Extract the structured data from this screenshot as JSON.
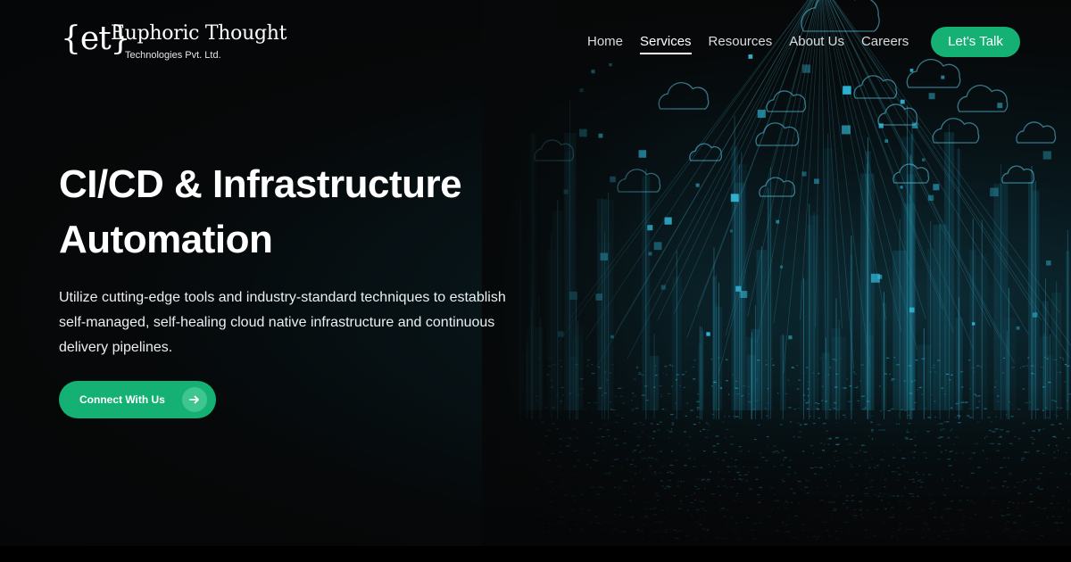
{
  "brand": {
    "mark": "{et}",
    "name": "Euphoric Thought",
    "subtitle": "Technologies Pvt. Ltd."
  },
  "nav": {
    "items": [
      {
        "label": "Home",
        "active": false
      },
      {
        "label": "Services",
        "active": true
      },
      {
        "label": "Resources",
        "active": false
      },
      {
        "label": "About Us",
        "active": false
      },
      {
        "label": "Careers",
        "active": false
      }
    ],
    "cta_label": "Let's Talk"
  },
  "hero": {
    "headline_line1": "CI/CD & Infrastructure",
    "headline_line2": "Automation",
    "subtext": "Utilize cutting-edge tools and industry-standard techniques to establish self-managed, self-healing cloud native infrastructure and continuous delivery pipelines.",
    "cta_label": "Connect With Us",
    "cta_icon": "arrow-right-icon",
    "background_image": "digital-cloud-cityscape"
  },
  "colors": {
    "accent": "#14b074",
    "accent_light": "#3fc690",
    "background": "#070809",
    "digital_teal": "#2fb4d6"
  }
}
